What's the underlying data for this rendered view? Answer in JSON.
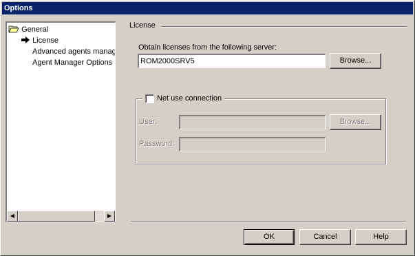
{
  "window": {
    "title": "Options"
  },
  "tree": {
    "items": [
      {
        "label": "General",
        "icon": "folder-open-icon"
      },
      {
        "label": "License",
        "icon": "arrow-right-icon"
      },
      {
        "label": "Advanced agents manag"
      },
      {
        "label": "Agent Manager Options"
      }
    ]
  },
  "license": {
    "section_title": "License",
    "server_label": "Obtain licenses from the following server:",
    "server_value": "ROM2000SRV5",
    "browse_label": "Browse...",
    "net_use": {
      "label": "Net use connection",
      "checked": false,
      "user_label": "User:",
      "user_value": "",
      "password_label": "Password:",
      "password_value": "",
      "browse_label": "Browse..."
    }
  },
  "footer": {
    "ok_label": "OK",
    "cancel_label": "Cancel",
    "help_label": "Help"
  }
}
